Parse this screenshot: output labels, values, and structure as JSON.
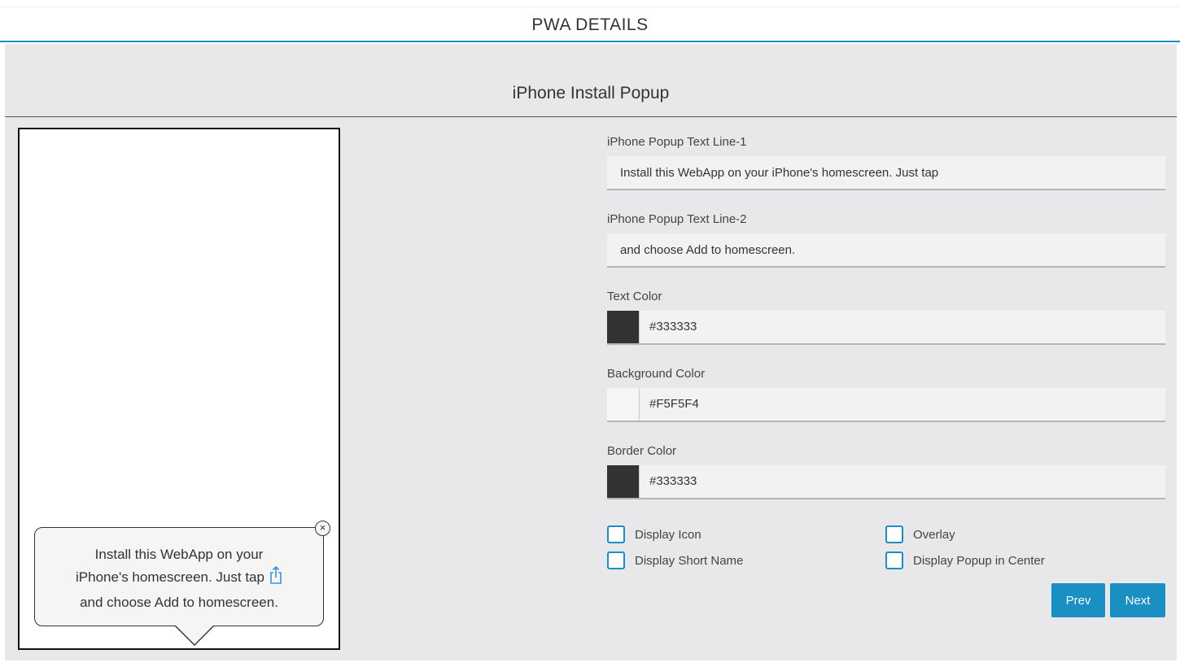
{
  "header": {
    "title": "PWA DETAILS"
  },
  "section": {
    "title": "iPhone Install Popup"
  },
  "preview": {
    "popup_line_1": "Install this WebApp on your",
    "popup_line_2": "iPhone's homescreen. Just tap",
    "popup_line_3": "and choose Add to homescreen.",
    "close_glyph": "×",
    "share_icon": "share-icon",
    "close_icon": "close-icon",
    "text_color": "#333333",
    "background_color": "#F5F5F4",
    "border_color": "#333333"
  },
  "form": {
    "line1": {
      "label": "iPhone Popup Text Line-1",
      "value": "Install this WebApp on your iPhone's homescreen. Just tap"
    },
    "line2": {
      "label": "iPhone Popup Text Line-2",
      "value": "and choose Add to homescreen."
    },
    "text_color": {
      "label": "Text Color",
      "value": "#333333"
    },
    "background_color": {
      "label": "Background Color",
      "value": "#F5F5F4"
    },
    "border_color": {
      "label": "Border Color",
      "value": "#333333"
    }
  },
  "options": {
    "display_icon": {
      "label": "Display Icon",
      "checked": false
    },
    "overlay": {
      "label": "Overlay",
      "checked": false
    },
    "display_short_name": {
      "label": "Display Short Name",
      "checked": false
    },
    "display_center": {
      "label": "Display Popup in Center",
      "checked": false
    }
  },
  "buttons": {
    "prev": "Prev",
    "next": "Next"
  },
  "colors": {
    "accent": "#1a8fc2",
    "panel_bg": "#e8e8ea",
    "input_bg": "#f2f2f2"
  }
}
